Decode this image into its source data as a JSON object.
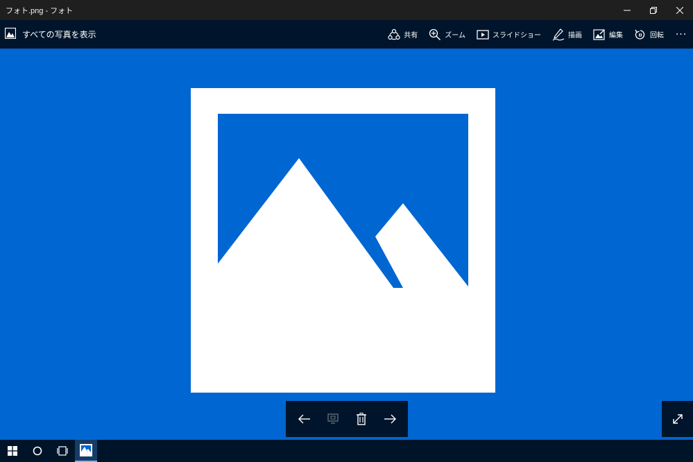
{
  "window": {
    "title": "フォト.png - フォト"
  },
  "cmdbar": {
    "back_label": "すべての写真を表示",
    "actions": [
      {
        "label": "共有",
        "icon": "share-icon"
      },
      {
        "label": "ズーム",
        "icon": "zoom-icon"
      },
      {
        "label": "スライドショー",
        "icon": "slideshow-icon"
      },
      {
        "label": "描画",
        "icon": "draw-icon"
      },
      {
        "label": "編集",
        "icon": "edit-icon"
      },
      {
        "label": "回転",
        "icon": "rotate-icon"
      }
    ],
    "more_label": "···"
  },
  "colors": {
    "background": "#0066d2",
    "bar": "#00152b",
    "titlebar": "#1f1f1f",
    "taskbar": "#001429",
    "image_blue": "#0066d2",
    "image_white": "#ffffff"
  },
  "navbar": {
    "buttons": [
      "previous-icon",
      "add-to-album-icon",
      "delete-icon",
      "next-icon"
    ]
  },
  "taskbar": {
    "items": [
      "windows-start-icon",
      "cortana-icon",
      "task-view-icon",
      "photos-app-icon"
    ]
  }
}
